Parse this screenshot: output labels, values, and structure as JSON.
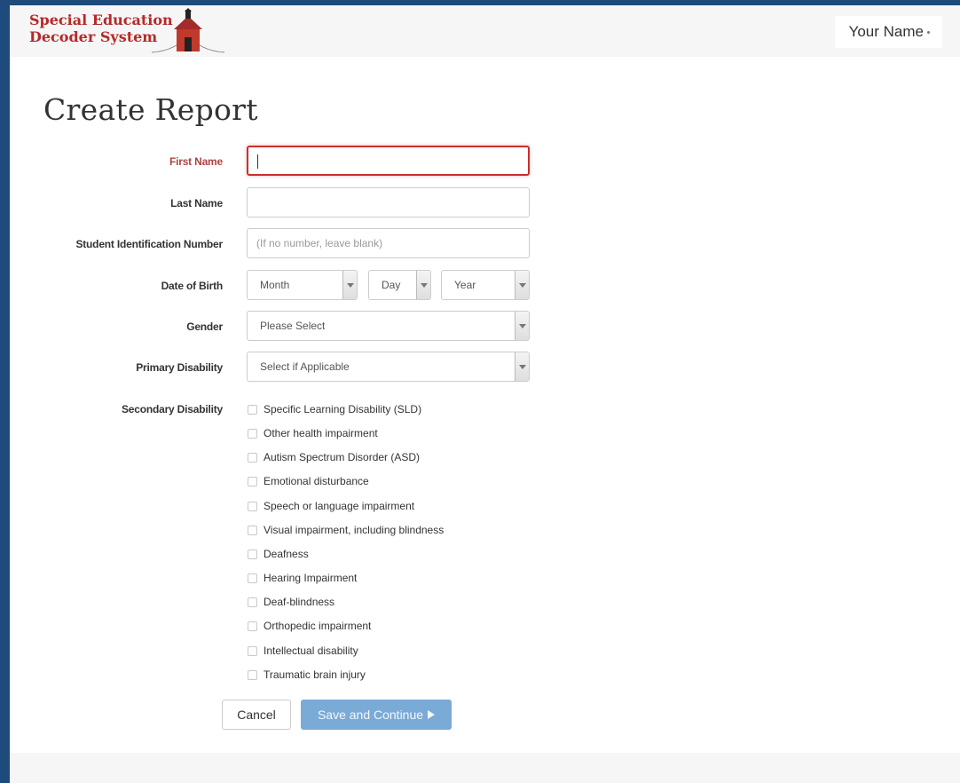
{
  "header": {
    "logo_line1": "Special Education",
    "logo_line2": "Decoder System",
    "logo_icon": "schoolhouse-icon",
    "user_name": "Your Name"
  },
  "page": {
    "title": "Create Report"
  },
  "form": {
    "first_name": {
      "label": "First Name",
      "value": ""
    },
    "last_name": {
      "label": "Last Name",
      "value": ""
    },
    "student_id": {
      "label": "Student Identification Number",
      "placeholder": "(If no number, leave blank)"
    },
    "dob": {
      "label": "Date of Birth",
      "month": "Month",
      "day": "Day",
      "year": "Year"
    },
    "gender": {
      "label": "Gender",
      "selected": "Please Select"
    },
    "primary_disability": {
      "label": "Primary Disability",
      "selected": "Select if Applicable"
    },
    "secondary_disability": {
      "label": "Secondary Disability",
      "options": [
        "Specific Learning Disability (SLD)",
        "Other health impairment",
        "Autism Spectrum Disorder (ASD)",
        "Emotional disturbance",
        "Speech or language impairment",
        "Visual impairment, including blindness",
        "Deafness",
        "Hearing Impairment",
        "Deaf-blindness",
        "Orthopedic impairment",
        "Intellectual disability",
        "Traumatic brain injury"
      ]
    }
  },
  "buttons": {
    "cancel": "Cancel",
    "save": "Save and Continue"
  },
  "colors": {
    "frame_border": "#1e4a7c",
    "brand_red": "#b52a2a",
    "primary_button": "#7aaad6",
    "required_label": "#a94442"
  }
}
